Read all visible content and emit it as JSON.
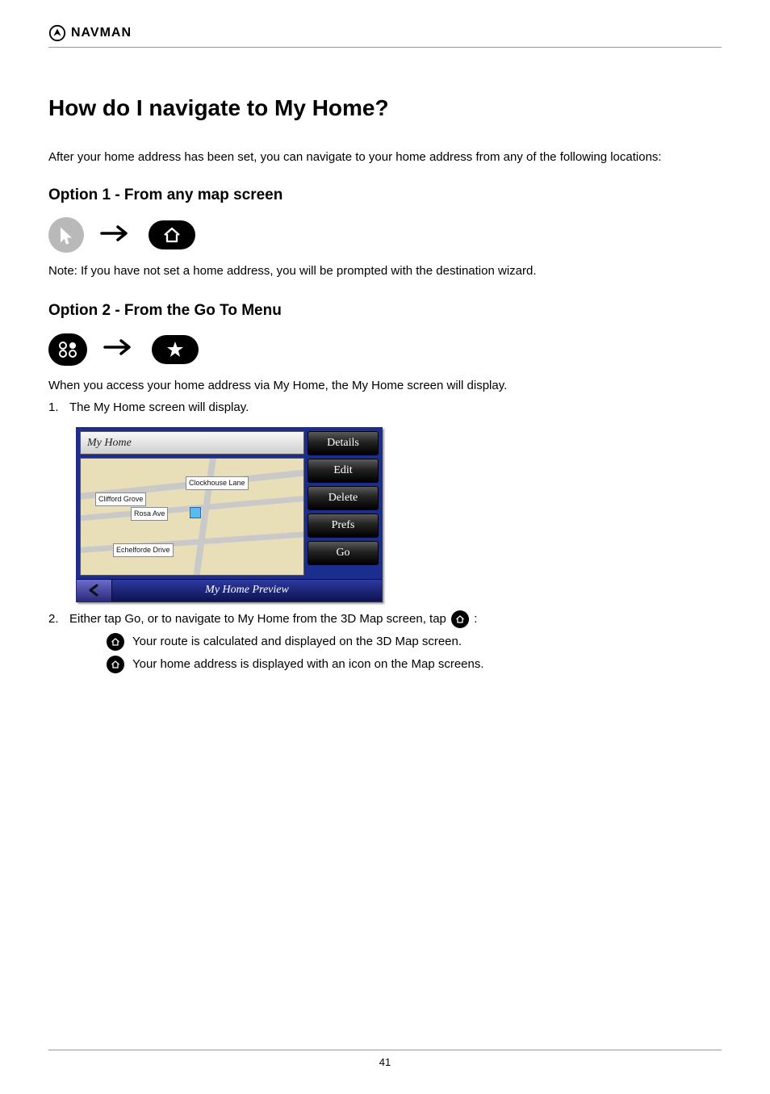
{
  "header": {
    "brand": "NAVMAN"
  },
  "title": "How do I navigate to My Home?",
  "intro": "After your home address has been set, you can navigate to your home address from any of the following locations:",
  "sections": {
    "option1": {
      "heading": "Option 1 - From any map screen",
      "note": "Note: If you have not set a home address, you will be prompted with the destination wizard."
    },
    "option2": {
      "heading": "Option 2 - From the Go To Menu"
    },
    "option3": {
      "text_before_list": "When you access your home address via My Home, the My Home screen will display.",
      "list1_prefix": "1.",
      "list1_text": "The My Home screen will display.",
      "list2_prefix": "2.",
      "list2_before": "Either tap Go, or to navigate to My Home from the 3D Map screen, tap ",
      "list2_after": ":"
    }
  },
  "sub_bullets": {
    "a": "Your route is calculated and displayed on the 3D Map screen. ",
    "b": "Your home address is displayed with an icon on the Map screens."
  },
  "device": {
    "title": "My Home",
    "footer": "My Home Preview",
    "buttons": {
      "details": "Details",
      "edit": "Edit",
      "delete": "Delete",
      "prefs": "Prefs",
      "go": "Go"
    },
    "map_labels": {
      "clockhouse": "Clockhouse Lane",
      "clifford": "Clifford Grove",
      "rosa": "Rosa Ave",
      "echelforde": "Echelforde Drive"
    }
  },
  "page_number": "41"
}
